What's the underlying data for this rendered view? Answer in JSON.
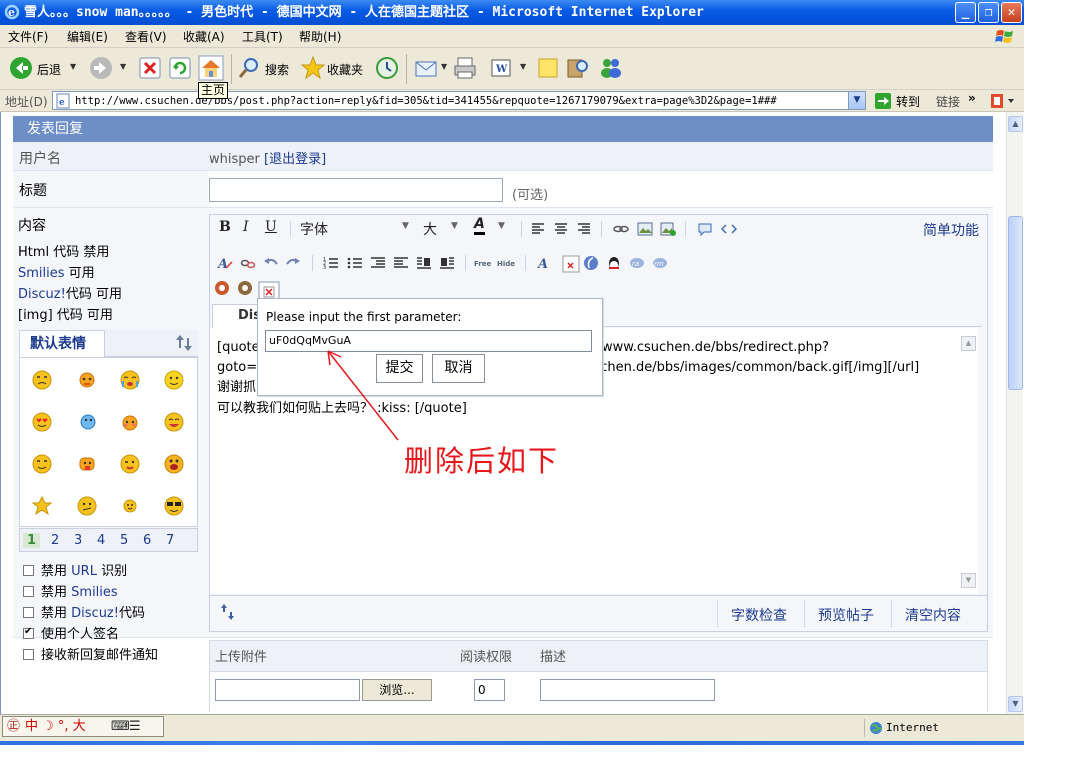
{
  "window": {
    "title": "雪人。。。snow man。。。。。 - 男色时代 - 德国中文网 - 人在德国主题社区 - Microsoft Internet Explorer",
    "buttons": {
      "minimize": "_",
      "restore": "❐",
      "close": "✕"
    }
  },
  "menu": [
    "文件(F)",
    "编辑(E)",
    "查看(V)",
    "收藏(A)",
    "工具(T)",
    "帮助(H)"
  ],
  "toolbar": {
    "back": "后退",
    "search": "搜索",
    "favorites": "收藏夹",
    "tooltip": "主页"
  },
  "address": {
    "label": "地址(D)",
    "url": "http://www.csuchen.de/bbs/post.php?action=reply&fid=305&tid=341455&repquote=1267179079&extra=page%3D2&page=1###",
    "go": "转到",
    "links": "链接",
    "more": "»"
  },
  "form": {
    "header": "发表回复",
    "username_label": "用户名",
    "username": "whisper",
    "logout": "[退出登录]",
    "title_label": "标题",
    "title_value": "",
    "title_optional": "(可选)",
    "content_label": "内容",
    "html_status": "Html 代码 禁用",
    "smilies_status_prefix": "Smilies",
    "smilies_status": " 可用",
    "discuz_status_prefix": "Discuz!",
    "discuz_status": "代码 可用",
    "img_status": "[img] 代码 可用"
  },
  "smilies": {
    "tab": "默认表情",
    "pages": [
      "1",
      "2",
      "3",
      "4",
      "5",
      "6",
      "7"
    ],
    "active_page": "1"
  },
  "options": [
    {
      "prefix": "禁用",
      "blue": " URL",
      "suffix": " 识别",
      "checked": false
    },
    {
      "prefix": "禁用",
      "blue": " Smilies",
      "suffix": "",
      "checked": false
    },
    {
      "prefix": "禁用",
      "blue": " Discuz!",
      "suffix": "代码",
      "checked": false
    },
    {
      "prefix": "使用个人签名",
      "blue": "",
      "suffix": "",
      "checked": true
    },
    {
      "prefix": "接收新回复邮件通知",
      "blue": "",
      "suffix": "",
      "checked": false
    }
  ],
  "editor": {
    "bold": "B",
    "italic": "I",
    "underline": "U",
    "font": "字体",
    "size": "大",
    "color": "A",
    "simple_mode": "简单功能",
    "tab": "Discuz!",
    "lines": [
      "[quote]",
      "goto=f",
      "谢谢抓",
      "可以教我们如何贴上去吗？ :kiss: [/quote]"
    ],
    "lines_right": [
      "www.csuchen.de/bbs/redirect.php?",
      "uchen.de/bbs/images/common/back.gif[/img][/url]"
    ],
    "word_count": "字数检查",
    "preview": "预览帖子",
    "clear": "清空内容"
  },
  "prompt": {
    "label": "Please input the first parameter:",
    "value": "uF0dQqMvGuA",
    "submit": "提交",
    "cancel": "取消"
  },
  "annotation": "删除后如下",
  "upload": {
    "attach": "上传附件",
    "permission": "阅读权限",
    "description": "描述",
    "browse": "浏览...",
    "permission_value": "0"
  },
  "status": {
    "zone": "Internet",
    "ime": "中 ☽ °, 大"
  }
}
